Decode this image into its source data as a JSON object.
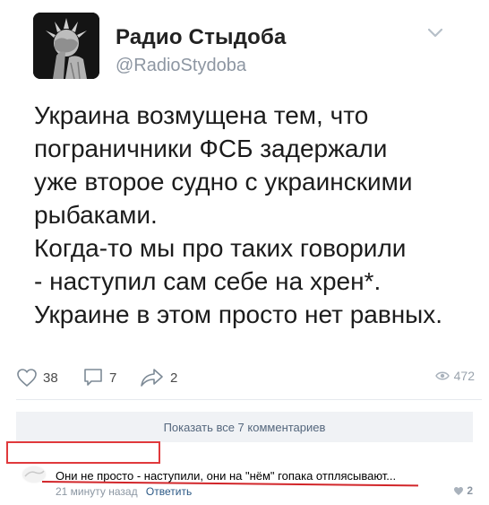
{
  "profile": {
    "name": "Радио Стыдоба",
    "handle": "@RadioStydoba"
  },
  "tweet": {
    "text": "Украина возмущена тем, что\nпограничники ФСБ  задержали\nуже второе судно с украинскими\nрыбаками.\nКогда-то мы про таких говорили\n- наступил сам себе на хрен*.\nУкраине в этом просто нет равных."
  },
  "actions": {
    "likes": "38",
    "comments": "7",
    "shares": "2",
    "views": "472"
  },
  "comments": {
    "show_all_label": "Показать все 7 комментариев",
    "items": [
      {
        "text": "Они не просто - наступили, они на \"нём\" гопака отплясывают...",
        "time": "21 минуту назад",
        "reply_label": "Ответить",
        "likes": "2"
      }
    ]
  },
  "icons": {
    "avatar": "statue-of-liberty-facepalm-icon",
    "chevron": "chevron-down-icon",
    "like": "heart-icon",
    "comment": "comment-bubble-icon",
    "share": "share-arrow-icon",
    "views": "eye-icon"
  },
  "colors": {
    "link": "#2a5885",
    "muted": "#8b96a2",
    "annotation_red": "#e0393c"
  }
}
